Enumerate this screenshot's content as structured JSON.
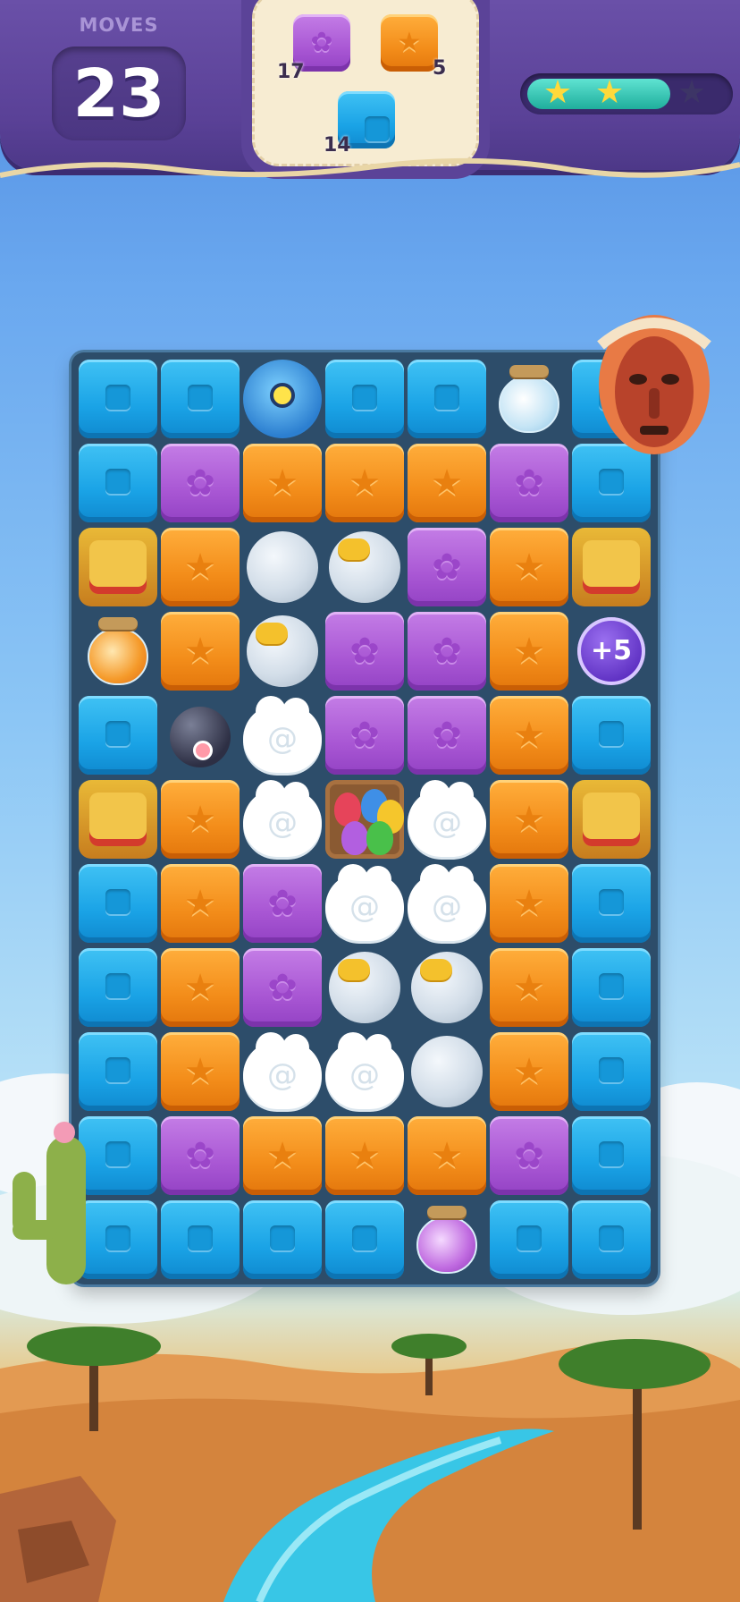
{
  "hud": {
    "moves_label": "MOVES",
    "moves_count": "23",
    "goals": [
      {
        "piece": "purple-flower-cube",
        "count": "17",
        "color": "#a957d4"
      },
      {
        "piece": "orange-star-cube",
        "count": "5",
        "color": "#f38d1a"
      },
      {
        "piece": "blue-square-cube",
        "count": "14",
        "color": "#1aa3e6"
      }
    ],
    "star_progress": {
      "stars_earned": 2,
      "stars_total": 3,
      "fill_fraction": 0.72
    }
  },
  "booster": {
    "label": "+5"
  },
  "board": {
    "columns": 7,
    "rows": 11,
    "legend": {
      "B": "blue-square-cube",
      "P": "purple-flower-cube",
      "O": "orange-star-cube",
      "L": "balloon",
      "R": "balloon-with-ribbon",
      "C": "cloud-blocker",
      "J": "glass-jar",
      "M": "tiki-mask",
      "X": "bomb",
      "E": "egg-basket",
      "U": "monster-egg",
      "F": "plus5-booster"
    },
    "cells": [
      [
        "B",
        "B",
        "U",
        "B",
        "B",
        "J",
        "B"
      ],
      [
        "B",
        "P",
        "O",
        "O",
        "O",
        "P",
        "B"
      ],
      [
        "M",
        "O",
        "L",
        "R",
        "P",
        "O",
        "M"
      ],
      [
        "J",
        "O",
        "R",
        "P",
        "P",
        "O",
        "F"
      ],
      [
        "B",
        "X",
        "C",
        "P",
        "P",
        "O",
        "B"
      ],
      [
        "M",
        "O",
        "C",
        "E",
        "C",
        "O",
        "M"
      ],
      [
        "B",
        "O",
        "P",
        "C",
        "C",
        "O",
        "B"
      ],
      [
        "B",
        "O",
        "P",
        "R",
        "R",
        "O",
        "B"
      ],
      [
        "B",
        "O",
        "C",
        "C",
        "L",
        "O",
        "B"
      ],
      [
        "B",
        "P",
        "O",
        "O",
        "O",
        "P",
        "B"
      ],
      [
        "B",
        "B",
        "B",
        "B",
        "J",
        "B",
        "B"
      ]
    ]
  },
  "colors": {
    "hud": "#5a4197",
    "board_bg": "#2d4d6a",
    "blue": "#1aa3e6",
    "purple": "#a957d4",
    "orange": "#f38d1a",
    "star": "#ffd93b"
  },
  "icons": {
    "flower": "✿",
    "star": "★",
    "swirl": "@",
    "hud_star": "★"
  }
}
